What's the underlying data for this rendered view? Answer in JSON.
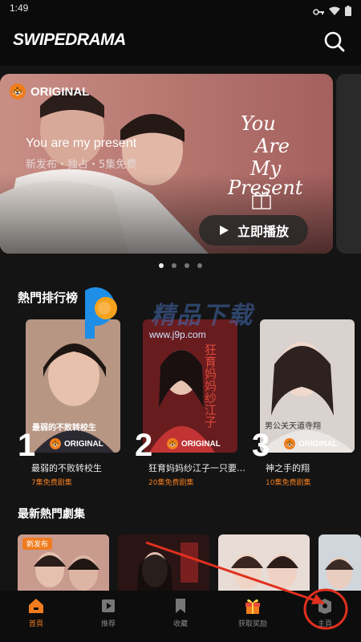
{
  "status_bar": {
    "time": "1:49"
  },
  "header": {
    "brand": "SWIPEDRAMA"
  },
  "hero": {
    "badge": "ORIGINAL",
    "art_title": [
      "You",
      "Are",
      "My",
      "Present"
    ],
    "title": "You are my present",
    "subtitle": "新发布・独占・5集免费",
    "play_label": "立即播放"
  },
  "carousel": {
    "count": 4,
    "active_index": 0
  },
  "ranking": {
    "title": "熱門排行榜",
    "items": [
      {
        "rank": "1",
        "badge": "ORIGINAL",
        "title": "最弱的不败转校生",
        "free": "7集免费剧集",
        "poster_text": "最弱的不败转校生"
      },
      {
        "rank": "2",
        "badge": "ORIGINAL",
        "title": "狂育妈妈纱江子一只要…",
        "free": "20集免费剧集",
        "poster_text": "狂育妈妈纱江子"
      },
      {
        "rank": "3",
        "badge": "ORIGINAL",
        "title": "神之手的翔",
        "free": "10集免费剧集",
        "poster_text": "男公关天道寺翔"
      }
    ]
  },
  "latest": {
    "title": "最新熱門劇集",
    "items": [
      {
        "badge": "新发布"
      },
      {
        "badge": ""
      },
      {
        "badge": ""
      },
      {
        "badge": ""
      }
    ]
  },
  "watermark": {
    "text": "精品下载",
    "url": "www.j9p.com"
  },
  "bottom_nav": {
    "items": [
      {
        "label": "首頁",
        "icon": "home-icon"
      },
      {
        "label": "推荐",
        "icon": "video-icon"
      },
      {
        "label": "收藏",
        "icon": "bookmark-icon"
      },
      {
        "label": "获取奖励",
        "icon": "gift-icon"
      },
      {
        "label": "主頁",
        "icon": "profile-icon"
      }
    ]
  },
  "colors": {
    "accent": "#f07c1e",
    "background": "#141414",
    "annotation": "#e0301e"
  }
}
